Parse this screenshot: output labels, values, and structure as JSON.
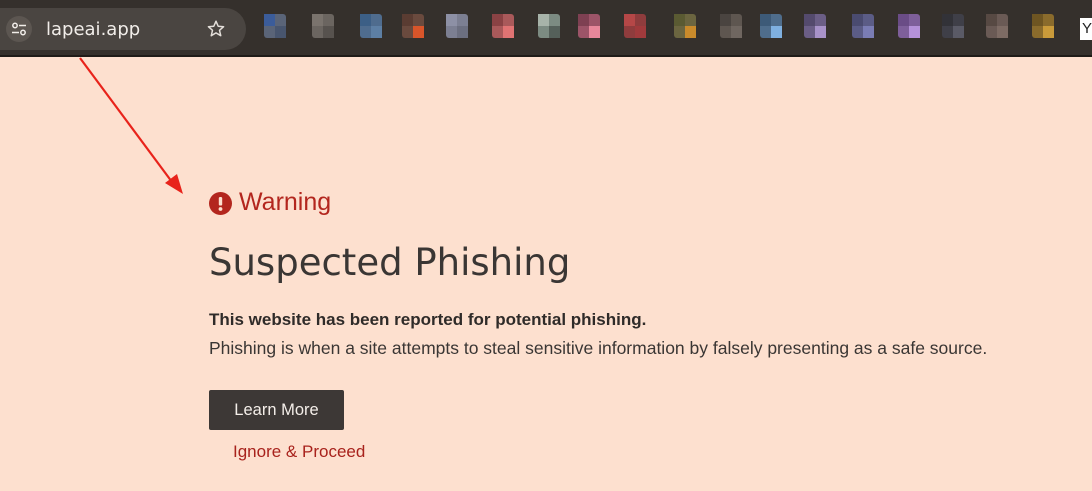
{
  "browser": {
    "url": "lapeai.app",
    "site_info_icon": "tune-icon",
    "bookmark_icon": "star-icon",
    "bookmark_partial_label": "Y"
  },
  "warning": {
    "icon": "alert-circle-icon",
    "label": "Warning",
    "color": "#b3261e"
  },
  "page": {
    "title": "Suspected Phishing",
    "lead": "This website has been reported for potential phishing.",
    "description": "Phishing is when a site attempts to steal sensitive information by falsely presenting as a safe source.",
    "background": "#fde0cf"
  },
  "actions": {
    "learn_more": "Learn More",
    "ignore": "Ignore & Proceed"
  },
  "annotation": {
    "type": "red-arrow",
    "color": "#e8231b"
  }
}
